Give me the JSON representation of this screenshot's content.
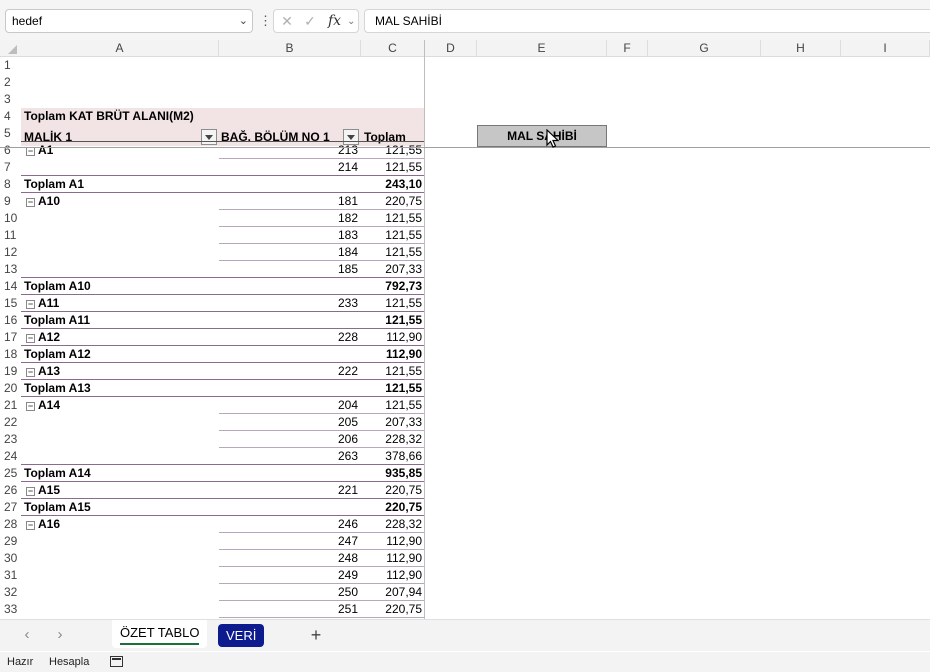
{
  "formula_bar": {
    "name_box": "hedef",
    "fx_label": "fx",
    "formula": "MAL SAHİBİ"
  },
  "columns": [
    "A",
    "B",
    "C",
    "D",
    "E",
    "F",
    "G",
    "H",
    "I"
  ],
  "rows": [
    "1",
    "2",
    "3",
    "4",
    "5",
    "6",
    "7",
    "8",
    "9",
    "10",
    "11",
    "12",
    "13",
    "14",
    "15",
    "16",
    "17",
    "18",
    "19",
    "20",
    "21",
    "22",
    "23",
    "24",
    "25",
    "26",
    "27",
    "28",
    "29",
    "30",
    "31",
    "32",
    "33"
  ],
  "pivot": {
    "title": "Toplam KAT BRÜT ALANI(M2)",
    "header_malik": "MALİK 1",
    "header_bolum": "BAĞ. BÖLÜM NO 1",
    "header_toplam": "Toplam",
    "rows": [
      {
        "type": "item",
        "group": "A1",
        "bolum": "213",
        "value": "121,55"
      },
      {
        "type": "item",
        "group": "",
        "bolum": "214",
        "value": "121,55"
      },
      {
        "type": "total",
        "label": "Toplam A1",
        "value": "243,10"
      },
      {
        "type": "item",
        "group": "A10",
        "bolum": "181",
        "value": "220,75"
      },
      {
        "type": "item",
        "group": "",
        "bolum": "182",
        "value": "121,55"
      },
      {
        "type": "item",
        "group": "",
        "bolum": "183",
        "value": "121,55"
      },
      {
        "type": "item",
        "group": "",
        "bolum": "184",
        "value": "121,55"
      },
      {
        "type": "item",
        "group": "",
        "bolum": "185",
        "value": "207,33"
      },
      {
        "type": "total",
        "label": "Toplam A10",
        "value": "792,73"
      },
      {
        "type": "item",
        "group": "A11",
        "bolum": "233",
        "value": "121,55"
      },
      {
        "type": "total",
        "label": "Toplam A11",
        "value": "121,55"
      },
      {
        "type": "item",
        "group": "A12",
        "bolum": "228",
        "value": "112,90"
      },
      {
        "type": "total",
        "label": "Toplam A12",
        "value": "112,90"
      },
      {
        "type": "item",
        "group": "A13",
        "bolum": "222",
        "value": "121,55"
      },
      {
        "type": "total",
        "label": "Toplam A13",
        "value": "121,55"
      },
      {
        "type": "item",
        "group": "A14",
        "bolum": "204",
        "value": "121,55"
      },
      {
        "type": "item",
        "group": "",
        "bolum": "205",
        "value": "207,33"
      },
      {
        "type": "item",
        "group": "",
        "bolum": "206",
        "value": "228,32"
      },
      {
        "type": "item",
        "group": "",
        "bolum": "263",
        "value": "378,66"
      },
      {
        "type": "total",
        "label": "Toplam A14",
        "value": "935,85"
      },
      {
        "type": "item",
        "group": "A15",
        "bolum": "221",
        "value": "220,75"
      },
      {
        "type": "total",
        "label": "Toplam A15",
        "value": "220,75"
      },
      {
        "type": "item",
        "group": "A16",
        "bolum": "246",
        "value": "228,32"
      },
      {
        "type": "item",
        "group": "",
        "bolum": "247",
        "value": "112,90"
      },
      {
        "type": "item",
        "group": "",
        "bolum": "248",
        "value": "112,90"
      },
      {
        "type": "item",
        "group": "",
        "bolum": "249",
        "value": "112,90"
      },
      {
        "type": "item",
        "group": "",
        "bolum": "250",
        "value": "207,94"
      },
      {
        "type": "item",
        "group": "",
        "bolum": "251",
        "value": "220,75"
      }
    ]
  },
  "slicer": {
    "title": "MAL SAHİBİ"
  },
  "sheet_tabs": [
    {
      "label": "ÖZET TABLO",
      "active": true
    },
    {
      "label": "VERİ",
      "active": false,
      "color": "#0e1b8f"
    }
  ],
  "status_bar": {
    "ready": "Hazır",
    "calc": "Hesapla"
  },
  "colors": {
    "pivot_header": "#f2e4e4",
    "pivot_line": "#8a6a8f",
    "slicer": "#c6c6c6"
  }
}
